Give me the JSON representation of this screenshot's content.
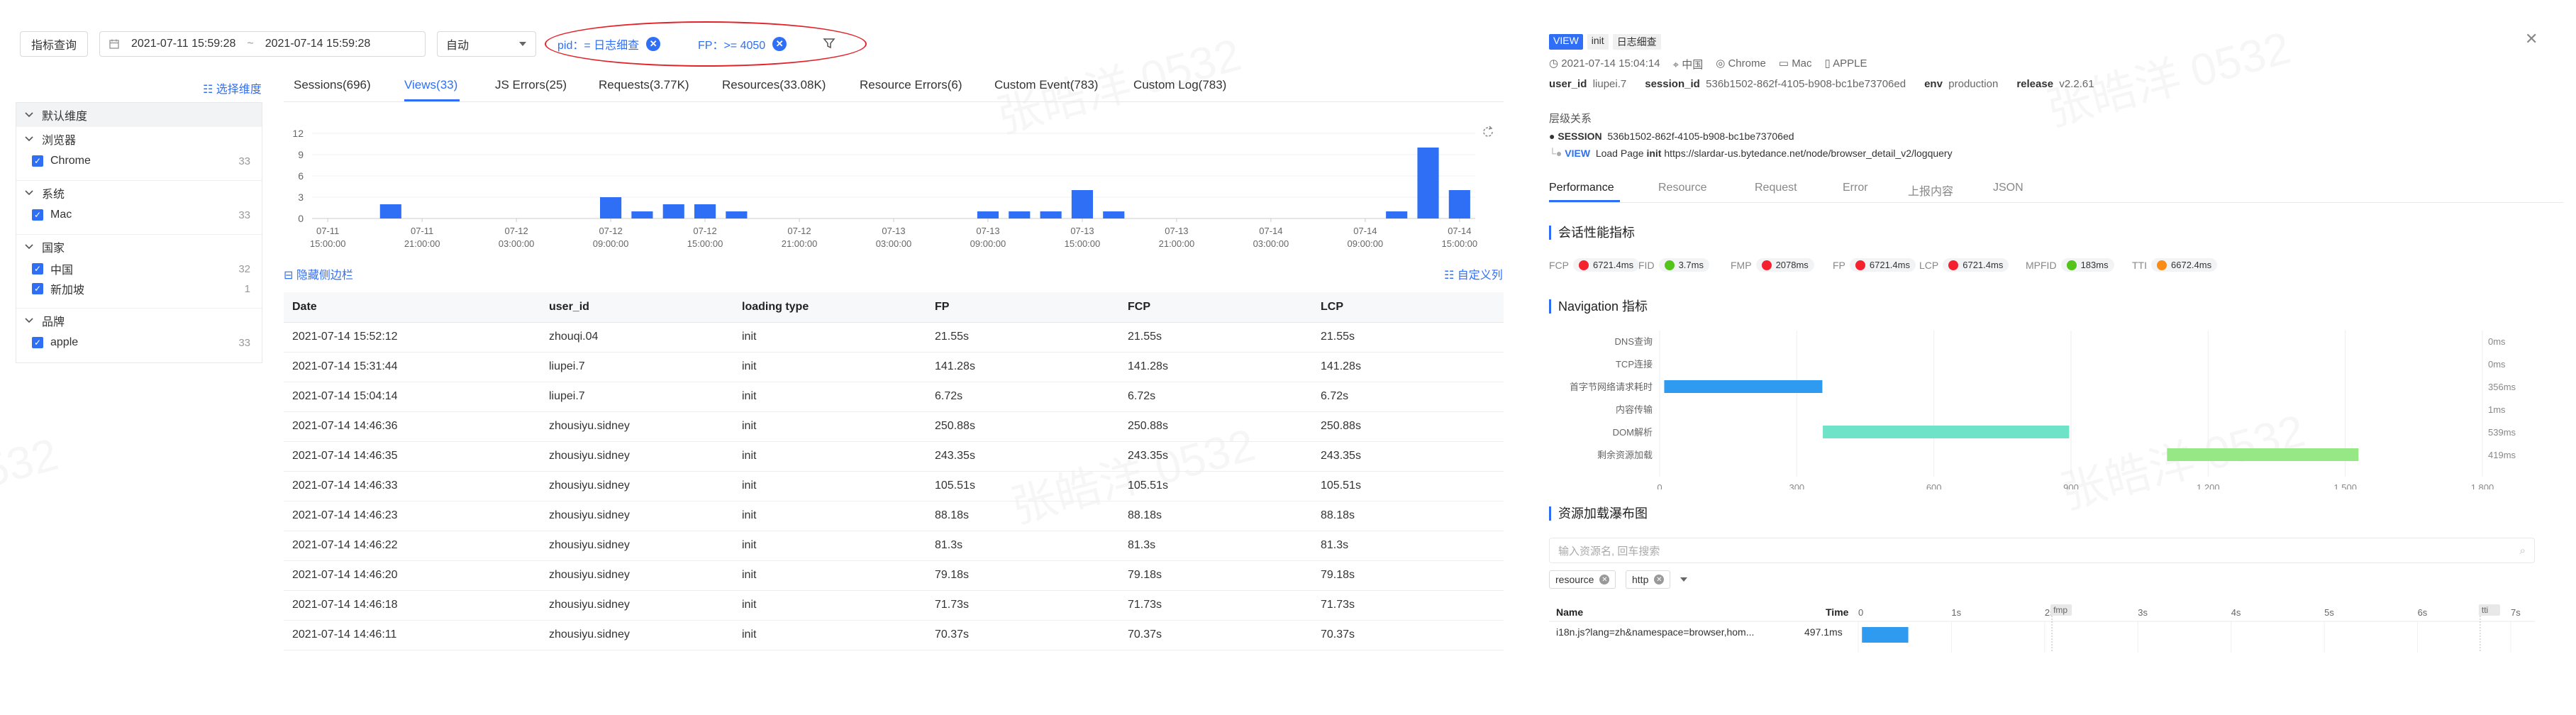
{
  "topbar": {
    "metric_button": "指标查询",
    "date_start": "2021-07-11 15:59:28",
    "date_sep": "~",
    "date_end": "2021-07-14 15:59:28",
    "auto_select": "自动",
    "filters": [
      {
        "label": "pid：= 日志细查"
      },
      {
        "label": "FP：>= 4050"
      }
    ]
  },
  "sidebar": {
    "select_dimension": "选择维度",
    "default_dimension": "默认维度",
    "groups": [
      {
        "title": "浏览器",
        "items": [
          {
            "label": "Chrome",
            "count": "33"
          }
        ]
      },
      {
        "title": "系统",
        "items": [
          {
            "label": "Mac",
            "count": "33"
          }
        ]
      },
      {
        "title": "国家",
        "items": [
          {
            "label": "中国",
            "count": "32"
          },
          {
            "label": "新加坡",
            "count": "1"
          }
        ]
      },
      {
        "title": "品牌",
        "items": [
          {
            "label": "apple",
            "count": "33"
          }
        ]
      }
    ]
  },
  "tabs": [
    "Sessions(696)",
    "Views(33)",
    "JS Errors(25)",
    "Requests(3.77K)",
    "Resources(33.08K)",
    "Resource Errors(6)",
    "Custom Event(783)",
    "Custom Log(783)"
  ],
  "active_tab_index": 1,
  "chart_data": {
    "type": "bar",
    "yticks": [
      "12",
      "9",
      "6",
      "3",
      "0"
    ],
    "ylim": [
      0,
      12
    ],
    "xticks": [
      [
        "07-11",
        "15:00:00"
      ],
      [
        "07-11",
        "21:00:00"
      ],
      [
        "07-12",
        "03:00:00"
      ],
      [
        "07-12",
        "09:00:00"
      ],
      [
        "07-12",
        "15:00:00"
      ],
      [
        "07-12",
        "21:00:00"
      ],
      [
        "07-13",
        "03:00:00"
      ],
      [
        "07-13",
        "09:00:00"
      ],
      [
        "07-13",
        "15:00:00"
      ],
      [
        "07-13",
        "21:00:00"
      ],
      [
        "07-14",
        "03:00:00"
      ],
      [
        "07-14",
        "09:00:00"
      ],
      [
        "07-14",
        "15:00:00"
      ]
    ],
    "bar_color": "#2f6ff5",
    "values": [
      0,
      0,
      2,
      0,
      0,
      0,
      0,
      0,
      0,
      3,
      1,
      2,
      2,
      1,
      0,
      0,
      0,
      0,
      0,
      0,
      0,
      1,
      1,
      1,
      4,
      1,
      0,
      0,
      0,
      0,
      0,
      0,
      0,
      0,
      1,
      10,
      4
    ]
  },
  "hide_sidebar": "隐藏侧边栏",
  "custom_columns": "自定义列",
  "table": {
    "headers": [
      "Date",
      "user_id",
      "loading type",
      "FP",
      "FCP",
      "LCP"
    ],
    "rows": [
      [
        "2021-07-14 15:52:12",
        "zhouqi.04",
        "init",
        "21.55s",
        "21.55s",
        "21.55s"
      ],
      [
        "2021-07-14 15:31:44",
        "liupei.7",
        "init",
        "141.28s",
        "141.28s",
        "141.28s"
      ],
      [
        "2021-07-14 15:04:14",
        "liupei.7",
        "init",
        "6.72s",
        "6.72s",
        "6.72s"
      ],
      [
        "2021-07-14 14:46:36",
        "zhousiyu.sidney",
        "init",
        "250.88s",
        "250.88s",
        "250.88s"
      ],
      [
        "2021-07-14 14:46:35",
        "zhousiyu.sidney",
        "init",
        "243.35s",
        "243.35s",
        "243.35s"
      ],
      [
        "2021-07-14 14:46:33",
        "zhousiyu.sidney",
        "init",
        "105.51s",
        "105.51s",
        "105.51s"
      ],
      [
        "2021-07-14 14:46:23",
        "zhousiyu.sidney",
        "init",
        "88.18s",
        "88.18s",
        "88.18s"
      ],
      [
        "2021-07-14 14:46:22",
        "zhousiyu.sidney",
        "init",
        "81.3s",
        "81.3s",
        "81.3s"
      ],
      [
        "2021-07-14 14:46:20",
        "zhousiyu.sidney",
        "init",
        "79.18s",
        "79.18s",
        "79.18s"
      ],
      [
        "2021-07-14 14:46:18",
        "zhousiyu.sidney",
        "init",
        "71.73s",
        "71.73s",
        "71.73s"
      ],
      [
        "2021-07-14 14:46:11",
        "zhousiyu.sidney",
        "init",
        "70.37s",
        "70.37s",
        "70.37s"
      ]
    ]
  },
  "detail": {
    "tag_view": "VIEW",
    "tag_init": "init",
    "tag_pid": "日志细查",
    "time": "2021-07-14 15:04:14",
    "country": "中国",
    "browser": "Chrome",
    "os": "Mac",
    "brand": "APPLE",
    "user_id_label": "user_id",
    "user_id": "liupei.7",
    "session_id_label": "session_id",
    "session_id": "536b1502-862f-4105-b908-bc1be73706ed",
    "env_label": "env",
    "env": "production",
    "release_label": "release",
    "release": "v2.2.61",
    "hierarchy_title": "层级关系",
    "session_tag": "SESSION",
    "session_value": "536b1502-862f-4105-b908-bc1be73706ed",
    "view_tag": "VIEW",
    "view_text_prefix": "Load Page",
    "view_text_init": "init",
    "view_url": "https://slardar-us.bytedance.net/node/browser_detail_v2/logquery",
    "tabs": [
      "Performance",
      "Resource",
      "Request",
      "Error",
      "上报内容",
      "JSON"
    ],
    "active_tab_index": 0,
    "perf_title": "会话性能指标",
    "metrics": [
      {
        "name": "FCP",
        "value": "6721.4ms",
        "color": "#f5222d"
      },
      {
        "name": "FID",
        "value": "3.7ms",
        "color": "#52c41a"
      },
      {
        "name": "FMP",
        "value": "2078ms",
        "color": "#f5222d"
      },
      {
        "name": "FP",
        "value": "6721.4ms",
        "color": "#f5222d"
      },
      {
        "name": "LCP",
        "value": "6721.4ms",
        "color": "#f5222d"
      },
      {
        "name": "MPFID",
        "value": "183ms",
        "color": "#52c41a"
      },
      {
        "name": "TTI",
        "value": "6672.4ms",
        "color": "#fa8c16"
      }
    ],
    "nav_title": "Navigation 指标",
    "nav_rows": [
      {
        "label": "DNS查询",
        "value": "0ms",
        "start": 0,
        "end": 0,
        "color": ""
      },
      {
        "label": "TCP连接",
        "value": "0ms",
        "start": 0,
        "end": 0,
        "color": ""
      },
      {
        "label": "首字节网络请求耗时",
        "value": "356ms",
        "start": 10,
        "end": 356,
        "color": "#2f9bf0"
      },
      {
        "label": "内容传输",
        "value": "1ms",
        "start": 356,
        "end": 357,
        "color": ""
      },
      {
        "label": "DOM解析",
        "value": "539ms",
        "start": 357,
        "end": 896,
        "color": "#6fe3c7"
      },
      {
        "label": "剩余资源加载",
        "value": "419ms",
        "start": 1110,
        "end": 1529,
        "color": "#96e887"
      }
    ],
    "nav_xticks": [
      "0",
      "300",
      "600",
      "900",
      "1,200",
      "1,500",
      "1,800"
    ],
    "nav_xmax": 1800,
    "waterfall_title": "资源加载瀑布图",
    "search_placeholder": "输入资源名, 回车搜索",
    "filter_resource": "resource",
    "filter_http": "http",
    "col_name": "Name",
    "col_time": "Time",
    "time_ticks": [
      "0",
      "1s",
      "2s",
      "3s",
      "4s",
      "5s",
      "6s",
      "7s"
    ],
    "marker_fmp": "fmp",
    "marker_tti": "tti",
    "resource_name": "i18n.js?lang=zh&namespace=browser,hom...",
    "resource_time": "497.1ms"
  }
}
